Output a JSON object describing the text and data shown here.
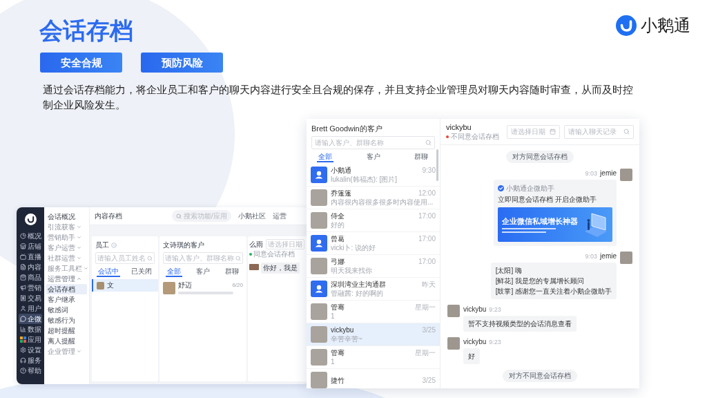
{
  "logo": {
    "text": "小鹅通"
  },
  "title": "会话存档",
  "tags": [
    "安全合规",
    "预防风险"
  ],
  "description": "通过会话存档能力，将企业员工和客户的聊天内容进行安全且合规的保存，并且支持企业管理员对聊天内容随时审查，从而及时控制企业风险发生。",
  "admin_window": {
    "nav": [
      {
        "label": "概况",
        "selected": false
      },
      {
        "label": "店铺",
        "selected": false
      },
      {
        "label": "直播",
        "selected": false
      },
      {
        "label": "内容",
        "selected": false
      },
      {
        "label": "商品",
        "selected": false
      },
      {
        "label": "营销",
        "selected": false
      },
      {
        "label": "交易",
        "selected": false
      },
      {
        "label": "用户",
        "selected": false
      },
      {
        "label": "企微",
        "selected": true
      },
      {
        "label": "数据",
        "selected": false
      },
      {
        "label": "应用",
        "selected": false
      },
      {
        "label": "设置",
        "selected": false
      },
      {
        "label": "服务",
        "selected": false
      },
      {
        "label": "帮助",
        "selected": false
      }
    ],
    "submenu": [
      {
        "kind": "link",
        "label": "会话概况",
        "selected": false
      },
      {
        "kind": "group",
        "label": "引流获客",
        "expanded": false
      },
      {
        "kind": "group",
        "label": "营销助手",
        "expanded": false
      },
      {
        "kind": "group",
        "label": "客户运营",
        "expanded": false
      },
      {
        "kind": "group",
        "label": "社群运营",
        "expanded": false
      },
      {
        "kind": "group",
        "label": "服务工具栏",
        "expanded": false
      },
      {
        "kind": "group",
        "label": "运营管理",
        "expanded": true,
        "children": [
          {
            "label": "会话存档",
            "selected": true
          },
          {
            "label": "客户继承",
            "selected": false
          },
          {
            "label": "敏感词",
            "selected": false
          },
          {
            "label": "敏感行为",
            "selected": false
          },
          {
            "label": "超时提醒",
            "selected": false
          },
          {
            "label": "离人提醒",
            "selected": false
          }
        ]
      },
      {
        "kind": "group",
        "label": "企业管理",
        "expanded": false
      }
    ],
    "breadcrumb": "内容存档",
    "search": {
      "placeholder": "搜索功能/应用"
    },
    "top_links": [
      "小鹅社区",
      "运营"
    ],
    "staff_panel": {
      "title": "员工",
      "search": {
        "placeholder": "请输入员工姓名"
      },
      "tabs": [
        {
          "label": "会话中",
          "selected": true
        },
        {
          "label": "已关闭",
          "selected": false
        }
      ],
      "rows": [
        {
          "name": "文",
          "selected": true
        }
      ]
    },
    "customer_panel": {
      "title": "文诗琪的客户",
      "search": {
        "placeholder": "请输入客户、群聊名称"
      },
      "tabs": [
        {
          "label": "全部",
          "selected": true
        },
        {
          "label": "客户",
          "selected": false
        },
        {
          "label": "群聊",
          "selected": false
        }
      ],
      "rows": [
        {
          "name": "妤迈",
          "time": "6/20",
          "selected": false
        }
      ]
    },
    "chat_panel": {
      "name": "么雨",
      "status": {
        "text": "同意会话存档",
        "agreed": true
      },
      "date_field": {
        "placeholder": "请选择日期"
      },
      "messages": [
        {
          "text": "你好，我是"
        }
      ]
    }
  },
  "chat_window": {
    "list": {
      "title": "Brett Goodwin的客户",
      "search": {
        "placeholder": "请输入客户、群聊名称"
      },
      "tabs": [
        {
          "label": "全部",
          "selected": true
        },
        {
          "label": "客户",
          "selected": false
        },
        {
          "label": "群聊",
          "selected": false
        }
      ],
      "conversations": [
        {
          "kind": "icon",
          "name": "小鹅通",
          "time": "9:30",
          "preview": "lukalin(韩福杰): [图片]",
          "selected": false
        },
        {
          "kind": "photo",
          "name": "乔篷篷",
          "time": "12:00",
          "preview": "内容很内容很多很多时内容使用...",
          "selected": false
        },
        {
          "kind": "photo",
          "name": "侍全",
          "time": "17:00",
          "preview": "好的",
          "selected": false
        },
        {
          "kind": "icon",
          "name": "曾葛",
          "time": "17:00",
          "preview": "vicki卜: 说的好",
          "selected": false
        },
        {
          "kind": "photo",
          "name": "弓娜",
          "time": "17:00",
          "preview": "明天我来找你",
          "selected": false
        },
        {
          "kind": "icon",
          "name": "深圳湾业主沟通群",
          "time": "昨天",
          "preview": "管融茜: 好的啊的",
          "selected": false
        },
        {
          "kind": "photo",
          "name": "管骞",
          "time": "星期一",
          "preview": "1",
          "selected": false
        },
        {
          "kind": "photo",
          "name": "vickybu",
          "time": "3/25",
          "preview": "辛苦辛苦~",
          "selected": true
        },
        {
          "kind": "photo",
          "name": "管骞",
          "time": "星期一",
          "preview": "1",
          "selected": false
        },
        {
          "kind": "photo",
          "name": "捷竹",
          "time": "3/25",
          "selected": false
        }
      ]
    },
    "chat": {
      "name": "vickybu",
      "status": {
        "text": "不同意会话存档",
        "agreed": false
      },
      "date_field": {
        "placeholder": "请选择日期"
      },
      "search": {
        "placeholder": "请输入聊天记录"
      },
      "messages": [
        {
          "kind": "system",
          "text": "对方同意会话存档"
        },
        {
          "kind": "sent_card",
          "sender": "jemie",
          "time": "9:03",
          "card": {
            "source": "小鹅通企微助手",
            "title": "立即同意会话存档 开启企微助手",
            "banner": "企业微信私域增长神器"
          }
        },
        {
          "kind": "sent_text",
          "sender": "jemie",
          "time": "9:03",
          "lines": [
            "[太阳] 嗨",
            "[鲜花] 我是您的专属增长顾问",
            "[鼓掌] 感谢您一直关注着小鹅企微助手"
          ]
        },
        {
          "kind": "received_text",
          "sender": "vickybu",
          "time": "9:23",
          "lines": [
            "暂不支持视频类型的会话消息查看"
          ]
        },
        {
          "kind": "received_text",
          "sender": "vickybu",
          "time": "9:23",
          "lines": [
            "好"
          ]
        },
        {
          "kind": "system",
          "text": "对方不同意会话存档"
        }
      ]
    }
  }
}
